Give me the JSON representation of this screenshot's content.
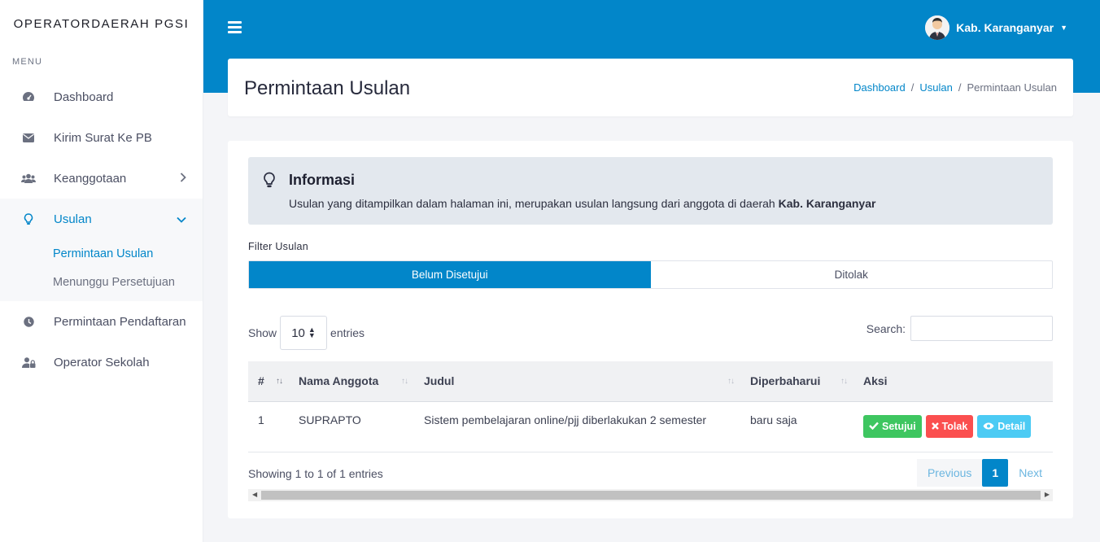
{
  "brand": "OPERATORDAERAH PGSI",
  "menu_header": "MENU",
  "sidebar": {
    "items": [
      {
        "label": "Dashboard",
        "icon": "dashboard-icon"
      },
      {
        "label": "Kirim Surat Ke PB",
        "icon": "envelope-icon"
      },
      {
        "label": "Keanggotaan",
        "icon": "users-icon"
      },
      {
        "label": "Usulan",
        "icon": "lightbulb-icon"
      },
      {
        "label": "Permintaan Pendaftaran",
        "icon": "clock-icon"
      },
      {
        "label": "Operator Sekolah",
        "icon": "user-lock-icon"
      }
    ],
    "submenu": [
      "Permintaan Usulan",
      "Menunggu Persetujuan"
    ]
  },
  "user": {
    "name": "Kab. Karanganyar"
  },
  "page": {
    "title": "Permintaan Usulan",
    "breadcrumb": [
      "Dashboard",
      "Usulan",
      "Permintaan Usulan"
    ],
    "separator": "/"
  },
  "info": {
    "title": "Informasi",
    "text": "Usulan yang ditampilkan dalam halaman ini, merupakan usulan langsung dari anggota di daerah ",
    "region": "Kab. Karanganyar"
  },
  "filter": {
    "label": "Filter Usulan",
    "tabs": [
      "Belum Disetujui",
      "Ditolak"
    ]
  },
  "table_controls": {
    "show": "Show",
    "entries_value": "10",
    "entries": "entries",
    "search": "Search:"
  },
  "table": {
    "headers": [
      "#",
      "Nama Anggota",
      "Judul",
      "Diperbaharui",
      "Aksi"
    ],
    "rows": [
      {
        "no": "1",
        "nama": "SUPRAPTO",
        "judul": "Sistem pembelajaran online/pjj diberlakukan 2 semester",
        "updated": "baru saja"
      }
    ],
    "actions": [
      "Setujui",
      "Tolak",
      "Detail"
    ]
  },
  "footer": {
    "showing": "Showing 1 to 1 of 1 entries",
    "previous": "Previous",
    "page": "1",
    "next": "Next"
  },
  "colors": {
    "primary": "#0286c9",
    "success": "#3ec660",
    "danger": "#fb4f4f",
    "info": "#4ccbf4"
  }
}
